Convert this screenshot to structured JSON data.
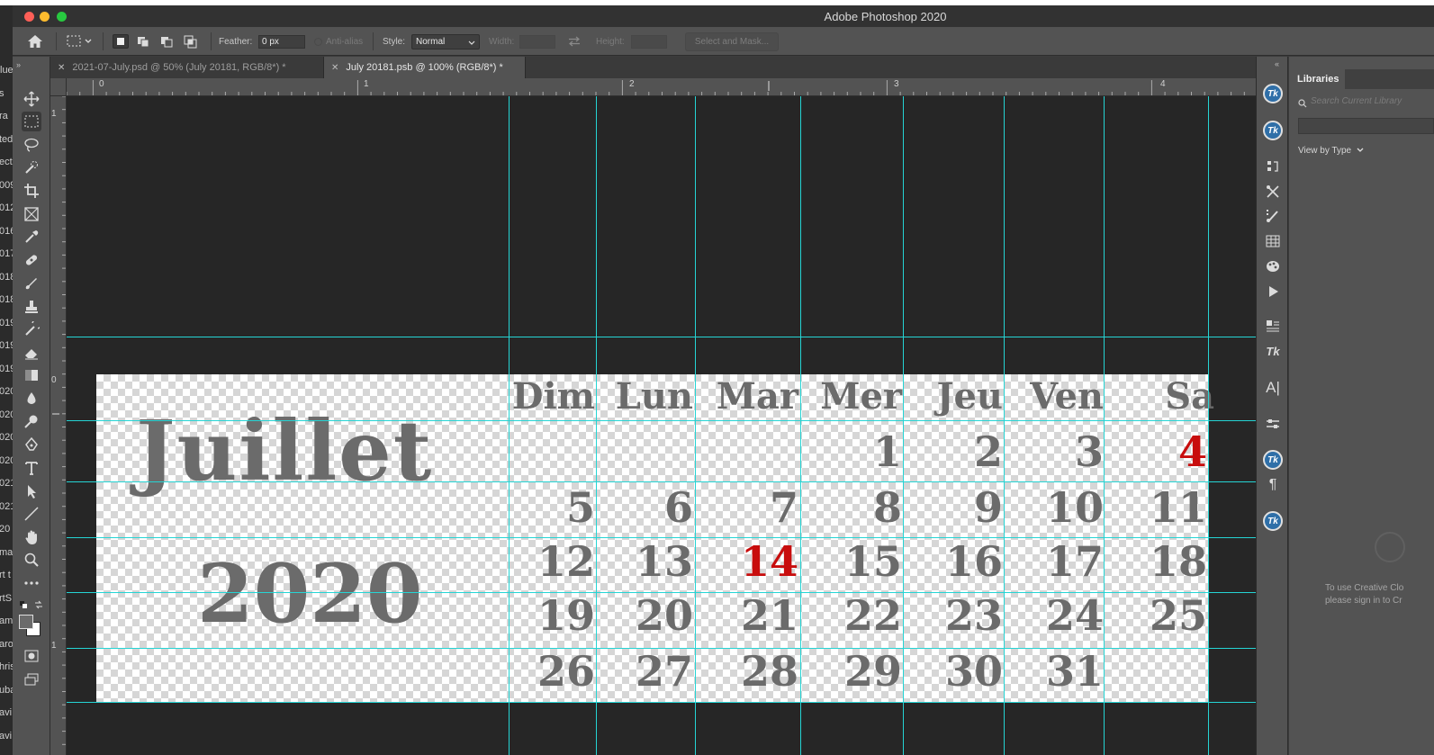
{
  "window": {
    "title": "Adobe Photoshop 2020"
  },
  "colors": {
    "guide": "#25d4d4",
    "accent_red": "#c80d0d",
    "text_gray": "#6b6b6b"
  },
  "side_fragments": [
    "lue",
    "s",
    "ra",
    "ted",
    "ect",
    "009",
    "012",
    "016",
    "017",
    "018",
    "018",
    "019",
    "019",
    "019",
    "020",
    "020",
    "020",
    "020",
    "021",
    "021",
    "20",
    "ma",
    "rt t",
    "rtS",
    "am",
    "aro",
    "hris",
    "uba",
    "avi",
    "avi"
  ],
  "options": {
    "feather_label": "Feather:",
    "feather_value": "0 px",
    "antialias_label": "Anti-alias",
    "style_label": "Style:",
    "style_value": "Normal",
    "width_label": "Width:",
    "height_label": "Height:",
    "select_mask_label": "Select and Mask..."
  },
  "tabs": [
    {
      "label": "2021-07-July.psd @ 50% (July 20181, RGB/8*) *"
    },
    {
      "label": "July 20181.psb @ 100% (RGB/8*) *"
    }
  ],
  "ruler": {
    "h_numbers": [
      "0",
      "1",
      "2",
      "3",
      "4"
    ],
    "v_numbers": [
      "1",
      "0",
      "1"
    ]
  },
  "tools": [
    "move-icon",
    "marquee-icon",
    "lasso-icon",
    "quick-select-icon",
    "crop-icon",
    "frame-icon",
    "eyedropper-icon",
    "healing-icon",
    "brush-icon",
    "stamp-icon",
    "history-brush-icon",
    "eraser-icon",
    "gradient-icon",
    "blur-icon",
    "dodge-icon",
    "pen-icon",
    "type-icon",
    "path-select-icon",
    "line-icon",
    "hand-icon",
    "zoom-icon",
    "more-icon"
  ],
  "calendar": {
    "month": "Juillet",
    "year": "2020",
    "days": [
      "Dim",
      "Lun",
      "Mar",
      "Mer",
      "Jeu",
      "Ven",
      "Sa"
    ],
    "weeks": [
      [
        "",
        "",
        "",
        "1",
        "2",
        "3",
        "4"
      ],
      [
        "5",
        "6",
        "7",
        "8",
        "9",
        "10",
        "11"
      ],
      [
        "12",
        "13",
        "14",
        "15",
        "16",
        "17",
        "18"
      ],
      [
        "19",
        "20",
        "21",
        "22",
        "23",
        "24",
        "25"
      ],
      [
        "26",
        "27",
        "28",
        "29",
        "30",
        "31",
        ""
      ]
    ],
    "red_days": [
      "4",
      "14"
    ]
  },
  "libraries": {
    "tab_label": "Libraries",
    "search_placeholder": "Search Current Library",
    "view_label": "View by Type",
    "message_line1": "To use Creative Clo",
    "message_line2": "please sign in to Cr"
  }
}
